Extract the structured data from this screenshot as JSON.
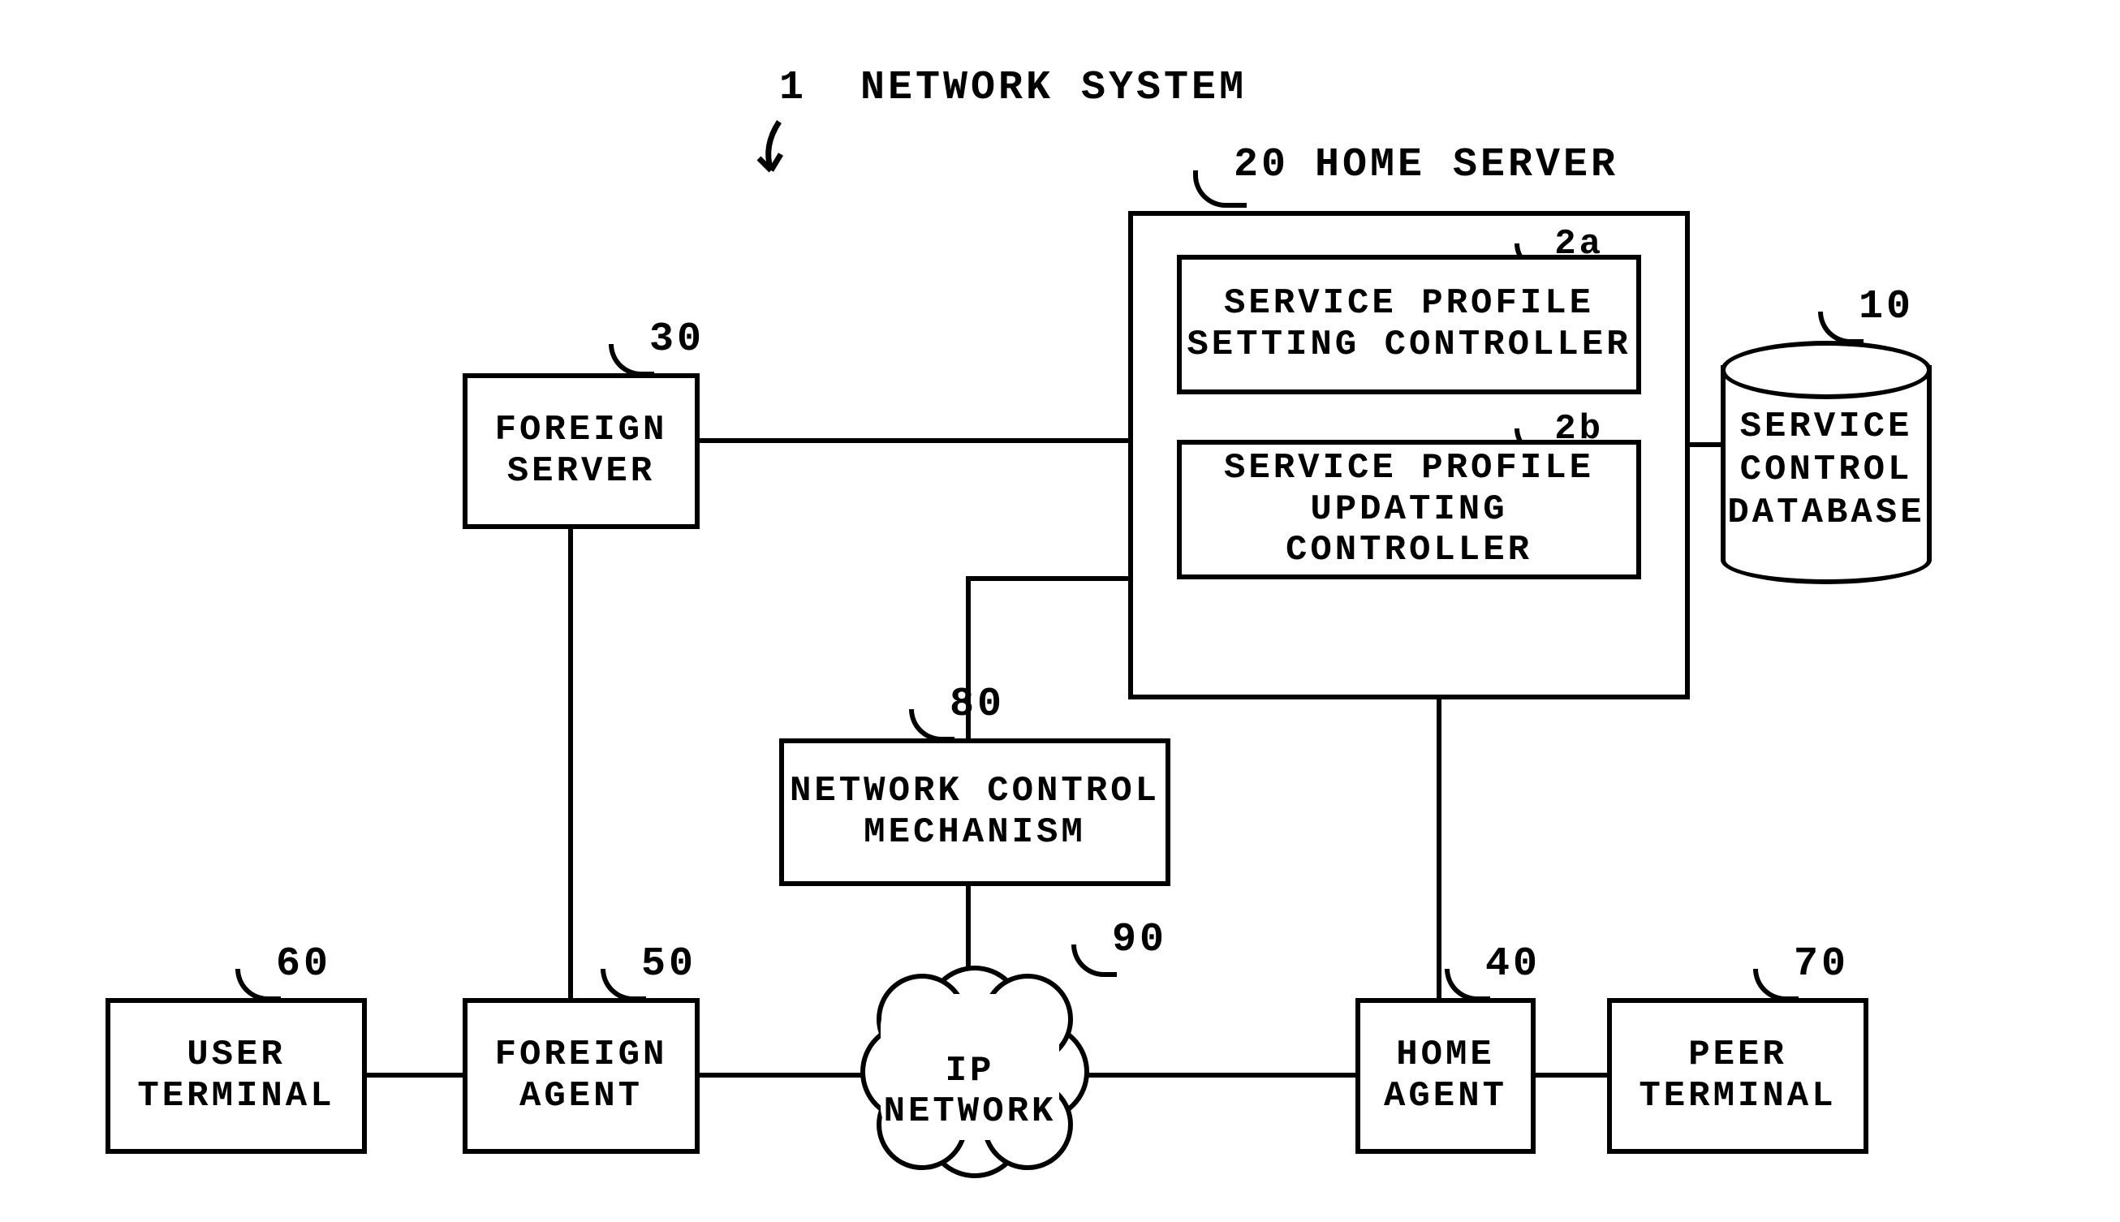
{
  "title_num": "1",
  "title_text": "NETWORK SYSTEM",
  "nodes": {
    "home_server": {
      "num": "20",
      "label": "HOME SERVER"
    },
    "sp_setting": {
      "num": "2a",
      "label_l1": "SERVICE PROFILE",
      "label_l2": "SETTING CONTROLLER"
    },
    "sp_update": {
      "num": "2b",
      "label_l1": "SERVICE PROFILE",
      "label_l2": "UPDATING CONTROLLER"
    },
    "db": {
      "num": "10",
      "label_l1": "SERVICE",
      "label_l2": "CONTROL",
      "label_l3": "DATABASE"
    },
    "foreign_srv": {
      "num": "30",
      "label_l1": "FOREIGN",
      "label_l2": "SERVER"
    },
    "ncm": {
      "num": "80",
      "label_l1": "NETWORK CONTROL",
      "label_l2": "MECHANISM"
    },
    "ip": {
      "num": "90",
      "label": "IP NETWORK"
    },
    "user_term": {
      "num": "60",
      "label_l1": "USER",
      "label_l2": "TERMINAL"
    },
    "foreign_ag": {
      "num": "50",
      "label_l1": "FOREIGN",
      "label_l2": "AGENT"
    },
    "home_ag": {
      "num": "40",
      "label_l1": "HOME",
      "label_l2": "AGENT"
    },
    "peer_term": {
      "num": "70",
      "label_l1": "PEER",
      "label_l2": "TERMINAL"
    }
  }
}
